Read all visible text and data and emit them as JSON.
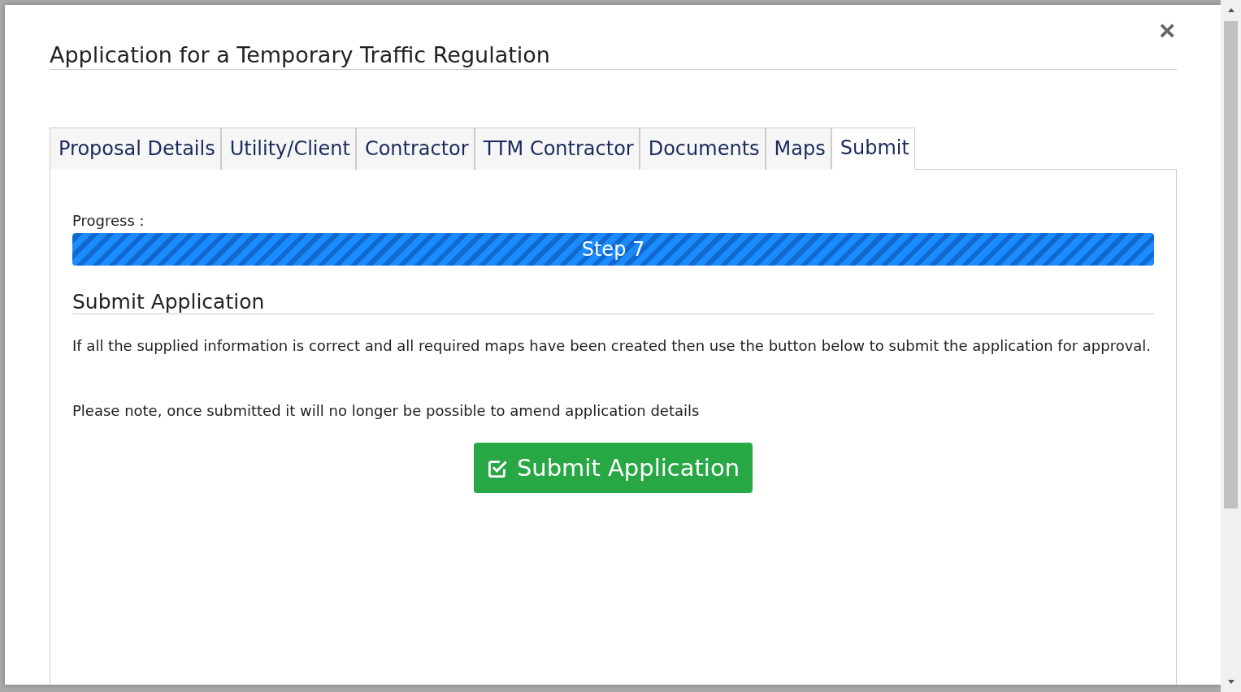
{
  "dialog": {
    "title": "Application for a Temporary Traffic Regulation",
    "close": "×"
  },
  "tabs": [
    {
      "label": "Proposal Details",
      "selected": false
    },
    {
      "label": "Utility/Client",
      "selected": false
    },
    {
      "label": "Contractor",
      "selected": false
    },
    {
      "label": "TTM Contractor",
      "selected": false
    },
    {
      "label": "Documents",
      "selected": false
    },
    {
      "label": "Maps",
      "selected": false
    },
    {
      "label": "Submit",
      "selected": true
    }
  ],
  "progress": {
    "label": "Progress :",
    "text": "Step 7",
    "level": 1
  },
  "section": {
    "heading": "Submit Application",
    "paragraphs": [
      "If all the supplied information is correct and all required maps have been created then use the button below to submit the application for approval.",
      "Please note, once submitted it will no longer be possible to amend application details"
    ]
  },
  "submit_button": "Submit Application"
}
